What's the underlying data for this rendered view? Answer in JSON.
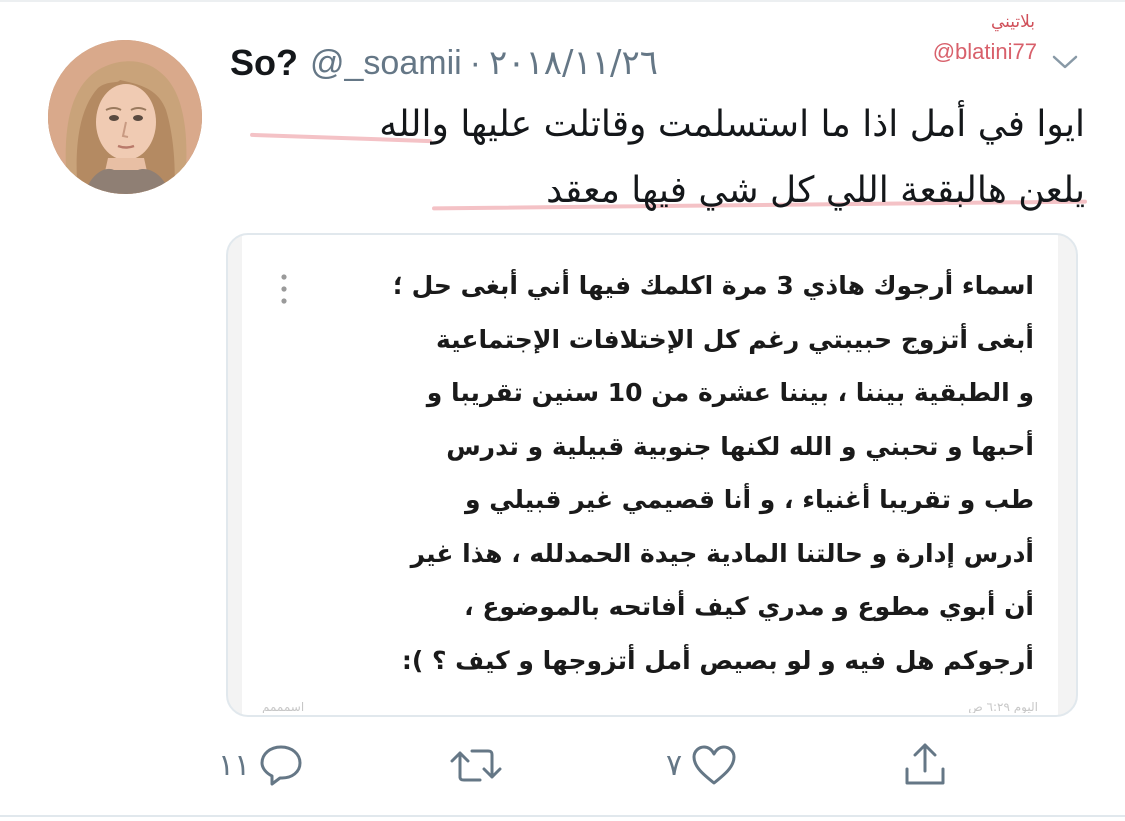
{
  "tweet": {
    "display_name": "So?",
    "handle": "@_soamii",
    "separator": "·",
    "date": "٢٠١٨/١١/٢٦",
    "text_lines": [
      "ايوا في أمل اذا ما استسلمت وقاتلت عليها والله",
      "يلعن هالبقعة اللي كل شي فيها معقد"
    ]
  },
  "watermark": {
    "arabic": "بلاتيني",
    "handle": "@blatini77"
  },
  "quoted_image": {
    "lines": [
      "اسماء أرجوك هاذي 3 مرة اكلمك فيها أني أبغى حل ؛",
      "أبغى أتزوج حبيبتي رغم كل الإختلافات الإجتماعية",
      "و الطبقية بيننا ، بيننا عشرة من 10 سنين تقريبا و",
      "أحبها و تحبني و الله لكنها جنوبية قبيلية و تدرس",
      "طب و تقريبا أغنياء ، و أنا قصيمي غير قبيلي و",
      "أدرس إدارة و حالتنا المادية جيدة الحمدلله ، هذا غير",
      "أن أبوي مطوع و مدري كيف أفاتحه بالموضوع ،",
      "أرجوكم هل فيه و لو بصيص أمل أتزوجها و كيف ؟ ):"
    ],
    "footer_left": "اسمممم",
    "footer_right": "اليوم ٦:٢٩ ص"
  },
  "actions": {
    "reply_count": "١١",
    "retweet_count": "",
    "like_count": "٧"
  },
  "colors": {
    "text": "#14171a",
    "secondary": "#657786",
    "watermark": "#d8606b",
    "highlight": "#f1b3b8"
  },
  "icons": [
    "menu-dots-icon",
    "chevron-down-icon",
    "reply-icon",
    "retweet-icon",
    "heart-icon",
    "share-icon"
  ]
}
